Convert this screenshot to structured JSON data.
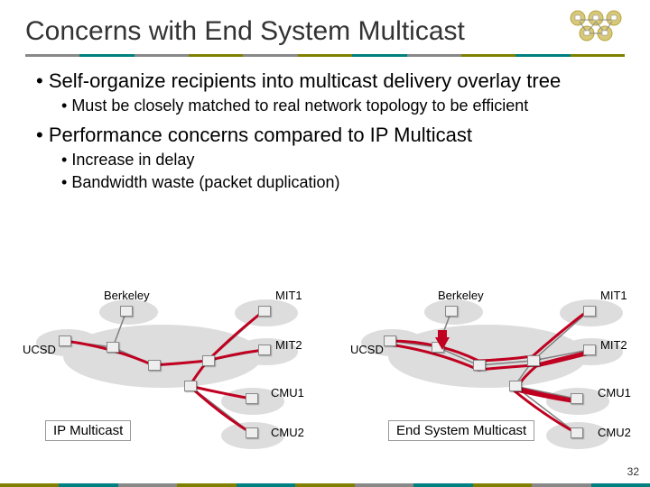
{
  "title": "Concerns with End System Multicast",
  "page_number": "32",
  "bullets": {
    "b1": "Self-organize recipients into multicast delivery overlay tree",
    "b1_sub1": "Must be closely matched to real network topology to be efficient",
    "b2": "Performance concerns compared to IP Multicast",
    "b2_sub1": "Increase in delay",
    "b2_sub2": "Bandwidth waste (packet duplication)"
  },
  "diagram": {
    "left": {
      "caption": "IP Multicast",
      "labels": {
        "berkeley": "Berkeley",
        "ucsd": "UCSD",
        "mit1": "MIT1",
        "mit2": "MIT2",
        "cmu1": "CMU1",
        "cmu2": "CMU2"
      }
    },
    "right": {
      "caption": "End System Multicast",
      "labels": {
        "berkeley": "Berkeley",
        "ucsd": "UCSD",
        "mit1": "MIT1",
        "mit2": "MIT2",
        "cmu1": "CMU1",
        "cmu2": "CMU2"
      }
    }
  },
  "colors": {
    "multicast_path": "#c00020",
    "link": "#808080",
    "cloud": "#dddddd",
    "olive": "#808000",
    "teal": "#008080"
  }
}
